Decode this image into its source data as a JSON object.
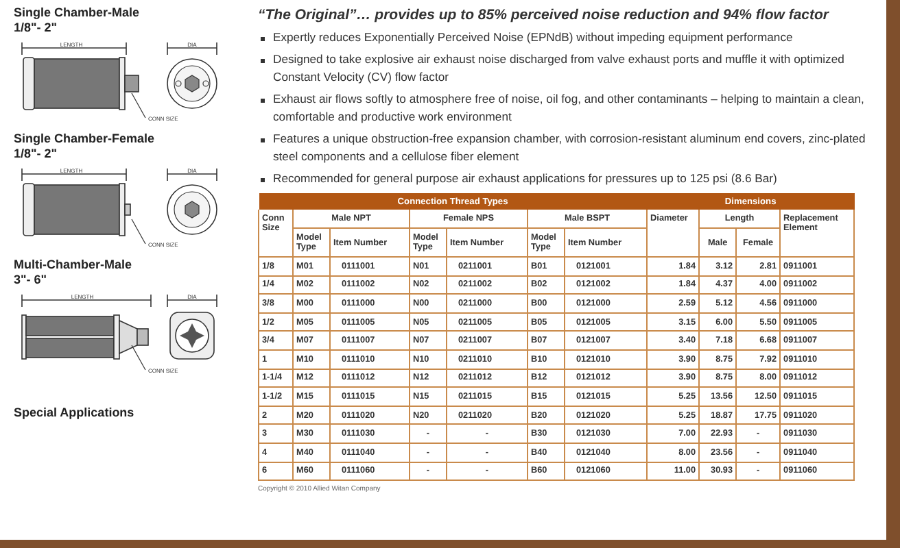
{
  "products": [
    {
      "title": "Single Chamber-Male",
      "range": "1/8\"- 2\"",
      "kind": "male",
      "labels": {
        "length": "LENGTH",
        "dia": "DIA",
        "conn": "CONN SIZE"
      }
    },
    {
      "title": "Single Chamber-Female",
      "range": "1/8\"- 2\"",
      "kind": "female",
      "labels": {
        "length": "LENGTH",
        "dia": "DIA",
        "conn": "CONN SIZE"
      }
    },
    {
      "title": "Multi-Chamber-Male",
      "range": "3\"- 6\"",
      "kind": "multi",
      "labels": {
        "length": "LENGTH",
        "dia": "DIA",
        "conn": "CONN SIZE"
      }
    }
  ],
  "special_applications": "Special Applications",
  "headline": "“The Original”… provides up to 85% perceived noise reduction and 94% flow factor",
  "bullets": [
    "Expertly reduces Exponentially Perceived Noise (EPNdB) without impeding equipment performance",
    "Designed to take explosive air exhaust noise discharged from valve exhaust ports and muffle it with optimized Constant Velocity (CV) flow factor",
    "Exhaust air flows softly to atmosphere free of noise, oil fog, and other contaminants – helping to maintain a clean, comfortable and productive work environment",
    "Features a unique obstruction-free expansion chamber, with corrosion-resistant aluminum end covers, zinc-plated steel components and a cellulose fiber element",
    "Recommended for general purpose air exhaust applications for pressures up to 125 psi (8.6 Bar)"
  ],
  "table": {
    "groups": [
      "Connection Thread Types",
      "Dimensions"
    ],
    "conn_size": "Conn Size",
    "male_npt": "Male NPT",
    "female_nps": "Female NPS",
    "male_bspt": "Male BSPT",
    "diameter": "Diameter",
    "length": "Length",
    "replacement": "Replacement Element",
    "model_type": [
      "Model Type",
      "Model Type",
      "Model Type"
    ],
    "item_number": [
      "Item Number",
      "Item Number",
      "Item Number"
    ],
    "male": "Male",
    "female": "Female",
    "rows": [
      [
        "1/8",
        "M01",
        "0111001",
        "N01",
        "0211001",
        "B01",
        "0121001",
        "1.84",
        "3.12",
        "2.81",
        "0911001"
      ],
      [
        "1/4",
        "M02",
        "0111002",
        "N02",
        "0211002",
        "B02",
        "0121002",
        "1.84",
        "4.37",
        "4.00",
        "0911002"
      ],
      [
        "3/8",
        "M00",
        "0111000",
        "N00",
        "0211000",
        "B00",
        "0121000",
        "2.59",
        "5.12",
        "4.56",
        "0911000"
      ],
      [
        "1/2",
        "M05",
        "0111005",
        "N05",
        "0211005",
        "B05",
        "0121005",
        "3.15",
        "6.00",
        "5.50",
        "0911005"
      ],
      [
        "3/4",
        "M07",
        "0111007",
        "N07",
        "0211007",
        "B07",
        "0121007",
        "3.40",
        "7.18",
        "6.68",
        "0911007"
      ],
      [
        "1",
        "M10",
        "0111010",
        "N10",
        "0211010",
        "B10",
        "0121010",
        "3.90",
        "8.75",
        "7.92",
        "0911010"
      ],
      [
        "1-1/4",
        "M12",
        "0111012",
        "N12",
        "0211012",
        "B12",
        "0121012",
        "3.90",
        "8.75",
        "8.00",
        "0911012"
      ],
      [
        "1-1/2",
        "M15",
        "0111015",
        "N15",
        "0211015",
        "B15",
        "0121015",
        "5.25",
        "13.56",
        "12.50",
        "0911015"
      ],
      [
        "2",
        "M20",
        "0111020",
        "N20",
        "0211020",
        "B20",
        "0121020",
        "5.25",
        "18.87",
        "17.75",
        "0911020"
      ],
      [
        "3",
        "M30",
        "0111030",
        "-",
        "-",
        "B30",
        "0121030",
        "7.00",
        "22.93",
        "-",
        "0911030"
      ],
      [
        "4",
        "M40",
        "0111040",
        "-",
        "-",
        "B40",
        "0121040",
        "8.00",
        "23.56",
        "-",
        "0911040"
      ],
      [
        "6",
        "M60",
        "0111060",
        "-",
        "-",
        "B60",
        "0121060",
        "11.00",
        "30.93",
        "-",
        "0911060"
      ]
    ]
  },
  "copyright": "Copyright © 2010 Allied Witan Company"
}
